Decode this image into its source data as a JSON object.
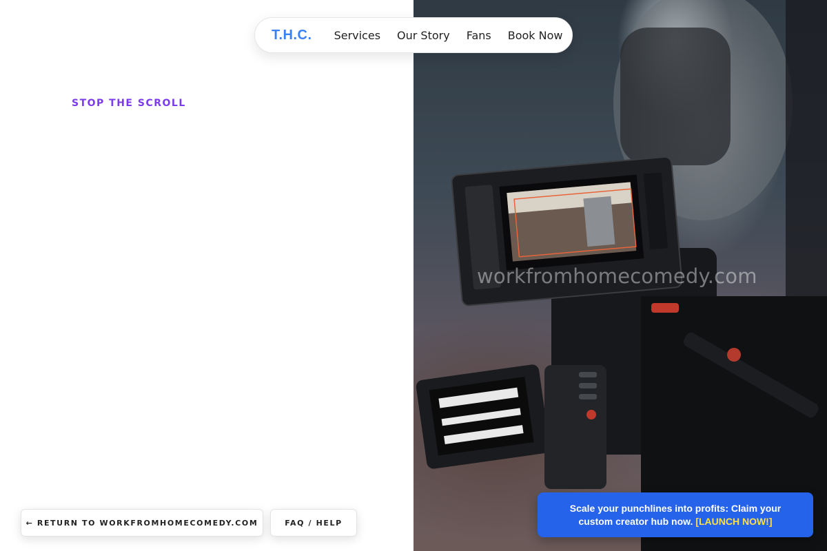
{
  "nav": {
    "brand": "T.H.C.",
    "links": [
      {
        "label": "Services"
      },
      {
        "label": "Our Story"
      },
      {
        "label": "Fans"
      },
      {
        "label": "Book Now"
      }
    ]
  },
  "hero": {
    "eyebrow": "STOP THE SCROLL",
    "watermark": "workfromhomecomedy.com"
  },
  "footer": {
    "return_label": "← RETURN TO WORKFROMHOMECOMEDY.COM",
    "faq_label": "FAQ / HELP"
  },
  "promo": {
    "text": "Scale your punchlines into profits: Claim your custom creator hub now.",
    "cta": "[LAUNCH NOW!]"
  },
  "colors": {
    "brand": "#3b82f6",
    "eyebrow": "#7c3aed",
    "promo_bg": "#2563eb",
    "promo_cta": "#fde047"
  }
}
